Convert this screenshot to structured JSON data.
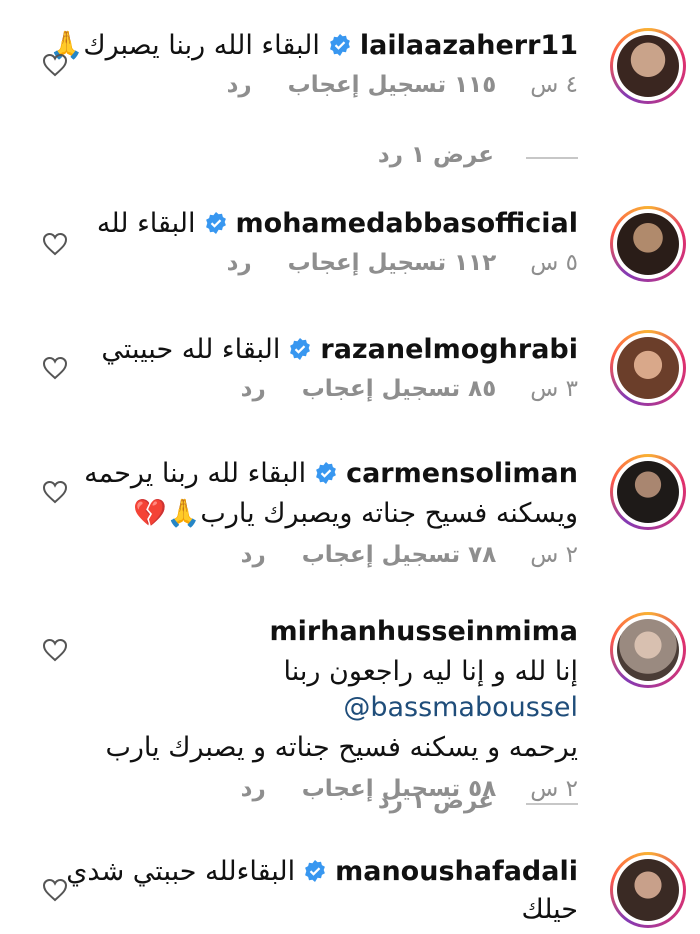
{
  "comments": [
    {
      "username": "lailaazaherr11",
      "verified": true,
      "text": "البقاء الله ربنا يصبرك🙏",
      "time": "٤ س",
      "likes": "١١٥ تسجيل إعجاب",
      "reply": "رد"
    },
    {
      "username": "mohamedabbasofficial",
      "verified": true,
      "text": "البقاء لله",
      "time": "٥ س",
      "likes": "١١٢ تسجيل إعجاب",
      "reply": "رد"
    },
    {
      "username": "razanelmoghrabi",
      "verified": true,
      "text": "البقاء لله حبيبتي",
      "time": "٣ س",
      "likes": "٨٥ تسجيل إعجاب",
      "reply": "رد"
    },
    {
      "username": "carmensoliman",
      "verified": true,
      "text": "البقاء لله ربنا يرحمه",
      "text2": "ويسكنه فسيح جناته ويصبرك يارب🙏💔",
      "time": "٢ س",
      "likes": "٧٨ تسجيل إعجاب",
      "reply": "رد"
    },
    {
      "username": "mirhanhusseinmima",
      "verified": false,
      "mention": "@bassmaboussel",
      "text": "إنا لله و إنا ليه راجعون ربنا",
      "text2": "يرحمه و يسكنه فسيح جناته و يصبرك يارب",
      "time": "٢ س",
      "likes": "٥٨ تسجيل إعجاب",
      "reply": "رد"
    },
    {
      "username": "manoushafadali",
      "verified": true,
      "text": "البقاءلله حببتي شدي",
      "text2": "حيلك"
    }
  ],
  "view_replies": [
    "عرض ١ رد",
    "عرض ١ رد"
  ],
  "colors": {
    "secondary_text": "#8e8e8e",
    "verified_blue": "#3897f0",
    "mention": "#1f4d7a"
  }
}
